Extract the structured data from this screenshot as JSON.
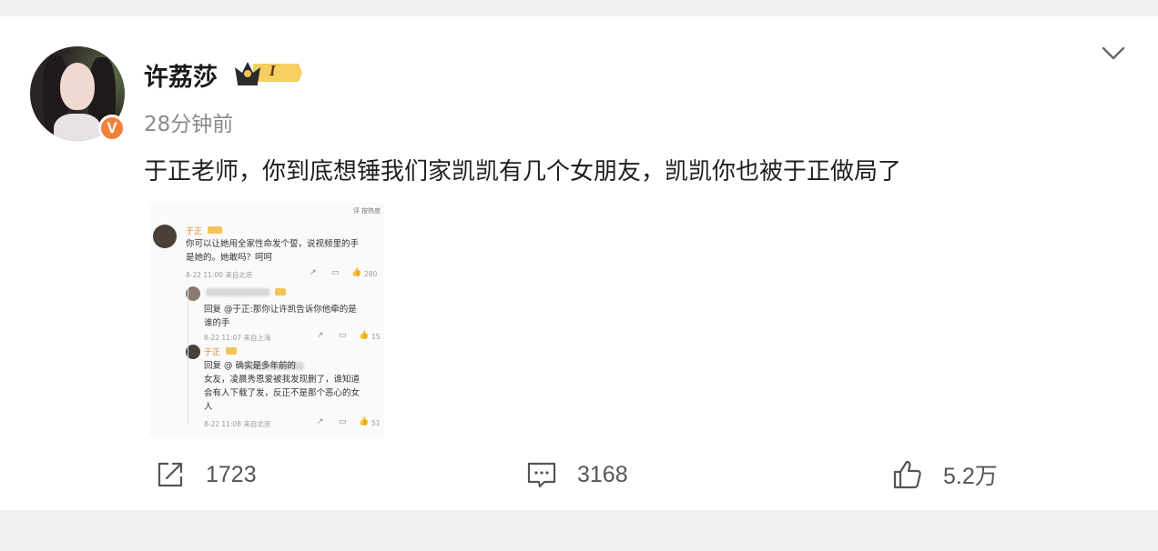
{
  "post": {
    "username": "许荔莎",
    "level_badge": "I",
    "time": "28分钟前",
    "text": "于正老师，你到底想锤我们家凯凯有几个女朋友，凯凯你也被于正做局了",
    "verified_badge": "V"
  },
  "embedded_image": {
    "top_tag": "评 按热度",
    "comments": [
      {
        "name": "于正",
        "text_lines": [
          "你可以让她用全家性命发个誓，说视频里的手",
          "是她的。她敢吗？呵呵"
        ],
        "meta": "8-22 11:00 来自北京",
        "likes": "280"
      },
      {
        "name": "",
        "text_lines": [
          "回复 @于正:那你让许凯告诉你他牵的是",
          "谁的手"
        ],
        "meta": "8-22 11:07 来自上海",
        "likes": "15"
      },
      {
        "name": "于正",
        "text_lines": [
          "回复 @                确实是多年前的",
          "女友，凌晨秀恩爱被我发现删了，谁知道",
          "会有人下载了发，反正不是那个恶心的女",
          "人"
        ],
        "meta": "8-22 11:08 来自北京",
        "likes": "51"
      }
    ]
  },
  "actions": {
    "repost_count": "1723",
    "comment_count": "3168",
    "like_count": "5.2万"
  },
  "icons": {
    "repost": "share-icon",
    "comment": "comment-icon",
    "like": "thumbs-up-icon",
    "menu": "chevron-down-icon"
  },
  "colors": {
    "verified": "#f0813a",
    "crown": "#f3c35a"
  }
}
